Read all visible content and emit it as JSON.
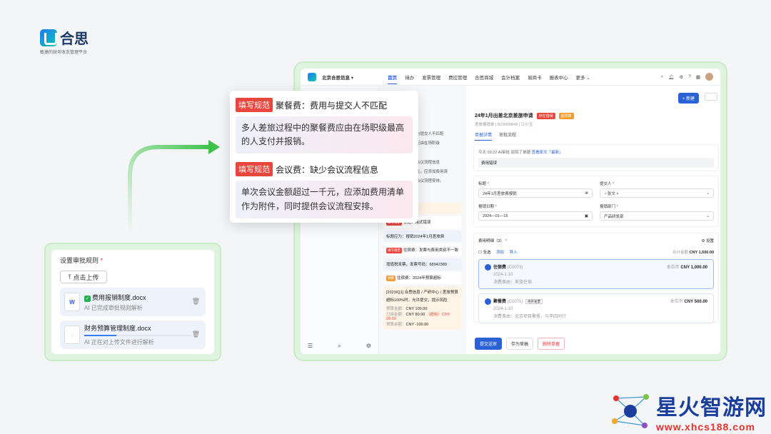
{
  "brand": {
    "name": "合思",
    "tagline": "敏捷的财务收支管理平台"
  },
  "upload": {
    "label": "设置审批规则",
    "required": "*",
    "button": "点击上传",
    "files": [
      {
        "name": "费用报销制度.docx",
        "status": "AI 已完成审批规则解析",
        "done": true
      },
      {
        "name": "财务预算管理制度.docx",
        "status": "AI 正在对上传文件进行解析",
        "done": false,
        "progress": 0.3
      }
    ]
  },
  "nav": {
    "company": "北京合思信息",
    "items": [
      "首页",
      "待办",
      "发票管理",
      "费控管理",
      "合思商城",
      "会计档案",
      "易商卡",
      "报表中心",
      "更多"
    ]
  },
  "popup": {
    "sections": [
      {
        "tag": "填写规范",
        "title": "聚餐费：费用与提交人不匹配",
        "body": "多人差旅过程中的聚餐费应由在场职级最高的人支付并报销。"
      },
      {
        "tag": "填写规范",
        "title": "会议费：缺少会议流程信息",
        "body": "单次会议金额超过一千元，应添加费用清单作为附件，同时提供会议流程安排。"
      }
    ]
  },
  "midcol": {
    "frag1": "与提交人不匹配",
    "frag2": "应由在场职级",
    "frag3": "会议流程信息",
    "frag4": "元，应添加费用清",
    "frag5": "会议流程安排。",
    "notice": "有可以规划的单据",
    "rule1_tag": "填写规范",
    "rule1_title": "标题：格式错误",
    "rule1_body": "标题应为：报销2024年1月差旅费",
    "rule2_tag": "填写规范",
    "rule2_title": "住宿费：发票与费用类别不一致",
    "rule2_body": "增值税发票，发票号码：68942389",
    "rule3_tag": "预算",
    "rule3_title": "住宿费：2024年预算超标",
    "rule3_body": "[2023/Q1] 合思信息 / 产研中心 / 差旅预算",
    "rule3_sub": "超标100%时，允许提交，提示风险",
    "budget_l1": "预算金额：",
    "budget_v1": "CNY 100.00",
    "budget_l2": "已用金额：",
    "budget_v2": "CNY 80.00",
    "budget_over": "（超标）CNY 20.00",
    "budget_l3": "预算余额：",
    "budget_v3": "CNY -100.00"
  },
  "main": {
    "new_button": "+ 新建",
    "title": "24年1月出差北京差旅申请",
    "tag1": "存在错误",
    "tag2": "超预算",
    "sub": "差旅报销单 | B23000849 | 江小玉",
    "tabs": [
      "单据详情",
      "审批流程"
    ],
    "log_time": "今天 09:22 AI审批",
    "log_action": "驳回了单据",
    "log_link": "查看原文「最新」",
    "log_comment": "费用错误",
    "f_title_label": "标题",
    "f_title_value": "24年1月差旅费报销",
    "f_submitter_label": "提交人",
    "f_submitter_value": "张文",
    "f_date_label": "报销日期",
    "f_date_value": "2024—01—15",
    "f_dept_label": "报销部门",
    "f_dept_value": "产品研发部",
    "detail_label": "费用明细（3）",
    "settings": "设置",
    "select_all": "全选",
    "add": "添加",
    "import": "导入",
    "total_label": "合计金额",
    "total_value": "CNY 1,500.00",
    "items": [
      {
        "name": "住宿费",
        "code": "(C0073)",
        "date": "2024-1-10",
        "note": "消费事由：差旅住宿",
        "cur_label": "本位币",
        "amount": "CNY 1,000.00"
      },
      {
        "name": "聚餐费",
        "code": "(C0071)",
        "badge": "待开发票",
        "date": "2024-1-10",
        "note": "消费事由：北京项目聚餐，与李四同行",
        "cur_label": "本位币",
        "amount": "CNY 500.00"
      }
    ],
    "btn_submit": "提交送审",
    "btn_draft": "存为草稿",
    "btn_delete": "删除单据"
  },
  "watermark": {
    "title": "星火智游网",
    "url": "www.xhcs188.com"
  },
  "colors": {
    "accent": "#2b61d6",
    "tag_red": "#e8453c",
    "frame_green": "#dff3df"
  }
}
